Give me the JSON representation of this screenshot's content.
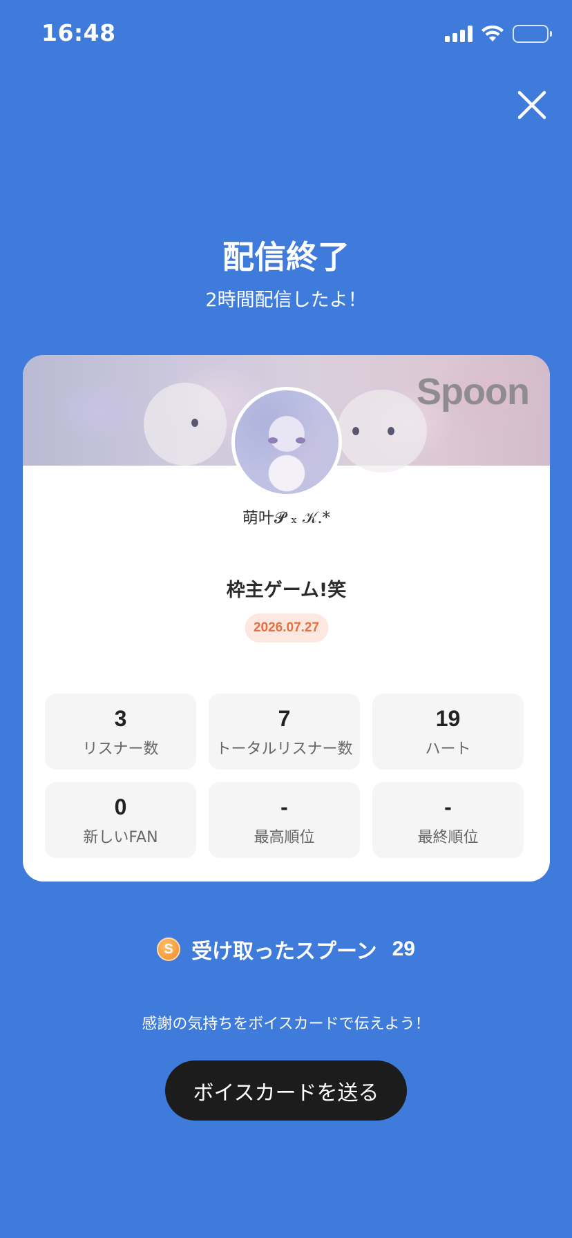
{
  "status_bar": {
    "time": "16:48"
  },
  "header": {
    "title": "配信終了",
    "subtitle": "2時間配信したよ！"
  },
  "card": {
    "brand": "Spoon",
    "username": "萌叶𝓟 ₓ 𝒦.*",
    "live_title": "枠主ゲーム!笑",
    "date": "2026.07.27",
    "stats": [
      {
        "value": "3",
        "label": "リスナー数"
      },
      {
        "value": "7",
        "label": "トータルリスナー数"
      },
      {
        "value": "19",
        "label": "ハート"
      },
      {
        "value": "0",
        "label": "新しいFAN"
      },
      {
        "value": "-",
        "label": "最高順位"
      },
      {
        "value": "-",
        "label": "最終順位"
      }
    ]
  },
  "spoons": {
    "coin_symbol": "S",
    "label": "受け取ったスプーン",
    "count": "29"
  },
  "thanks_text": "感謝の気持ちをボイスカードで伝えよう！",
  "voice_card_button": "ボイスカードを送る",
  "colors": {
    "background": "#3f7bdb",
    "button": "#1c1c1c",
    "date_badge_text": "#e8703f",
    "date_badge_bg": "#fde8e1"
  }
}
